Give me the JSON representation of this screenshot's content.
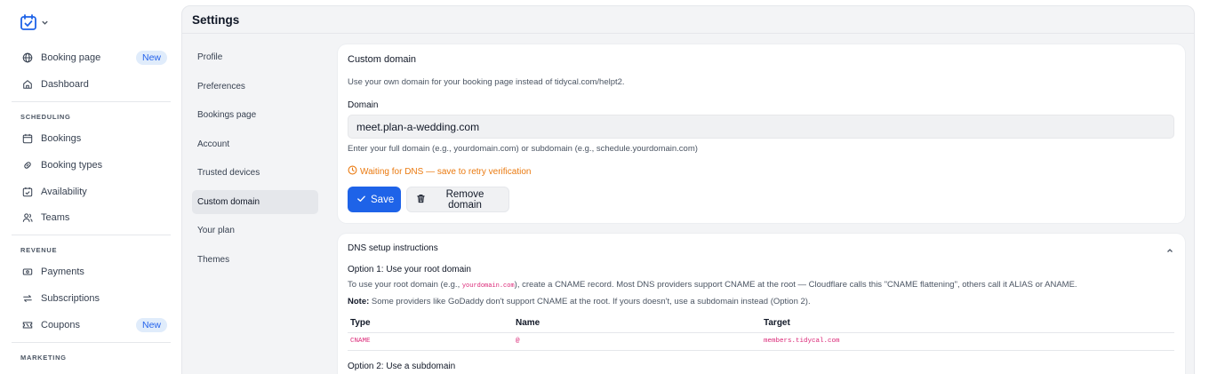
{
  "sidebar": {
    "logo_icon": "calendar-check-icon",
    "items_top": [
      {
        "label": "Booking page",
        "icon": "globe-icon",
        "badge": "New"
      },
      {
        "label": "Dashboard",
        "icon": "home-icon"
      }
    ],
    "scheduling_label": "SCHEDULING",
    "scheduling_items": [
      {
        "label": "Bookings",
        "icon": "calendar-icon"
      },
      {
        "label": "Booking types",
        "icon": "link-icon"
      },
      {
        "label": "Availability",
        "icon": "calendar-check-icon"
      },
      {
        "label": "Teams",
        "icon": "users-icon"
      }
    ],
    "revenue_label": "REVENUE",
    "revenue_items": [
      {
        "label": "Payments",
        "icon": "banknote-icon"
      },
      {
        "label": "Subscriptions",
        "icon": "repeat-icon"
      },
      {
        "label": "Coupons",
        "icon": "ticket-icon",
        "badge": "New"
      }
    ],
    "marketing_label": "MARKETING"
  },
  "main": {
    "title": "Settings",
    "subnav": [
      "Profile",
      "Preferences",
      "Bookings page",
      "Account",
      "Trusted devices",
      "Custom domain",
      "Your plan",
      "Themes"
    ],
    "active_subnav": "Custom domain"
  },
  "custom_domain": {
    "title": "Custom domain",
    "description": "Use your own domain for your booking page instead of tidycal.com/helpt2.",
    "domain_label": "Domain",
    "domain_value": "meet.plan-a-wedding.com",
    "hint": "Enter your full domain (e.g., yourdomain.com) or subdomain (e.g., schedule.yourdomain.com)",
    "status": "Waiting for DNS — save to retry verification",
    "save_label": "Save",
    "remove_label": "Remove domain"
  },
  "dns": {
    "title": "DNS setup instructions",
    "option1_title": "Option 1: Use your root domain",
    "option1_text_a": "To use your root domain (e.g., ",
    "option1_code": "yourdomain.com",
    "option1_text_b": "), create a CNAME record. Most DNS providers support CNAME at the root — Cloudflare calls this \"CNAME flattening\", others call it ALIAS or ANAME.",
    "note_label": "Note:",
    "note_text": " Some providers like GoDaddy don't support CNAME at the root. If yours doesn't, use a subdomain instead (Option 2).",
    "table_headers": [
      "Type",
      "Name",
      "Target"
    ],
    "table_rows": [
      [
        "CNAME",
        "@",
        "members.tidycal.com"
      ]
    ],
    "option2_title": "Option 2: Use a subdomain"
  },
  "colors": {
    "accent": "#1e63e8",
    "warning": "#ea7a10",
    "code": "#db2777",
    "badge_bg": "#e0ecfb"
  }
}
